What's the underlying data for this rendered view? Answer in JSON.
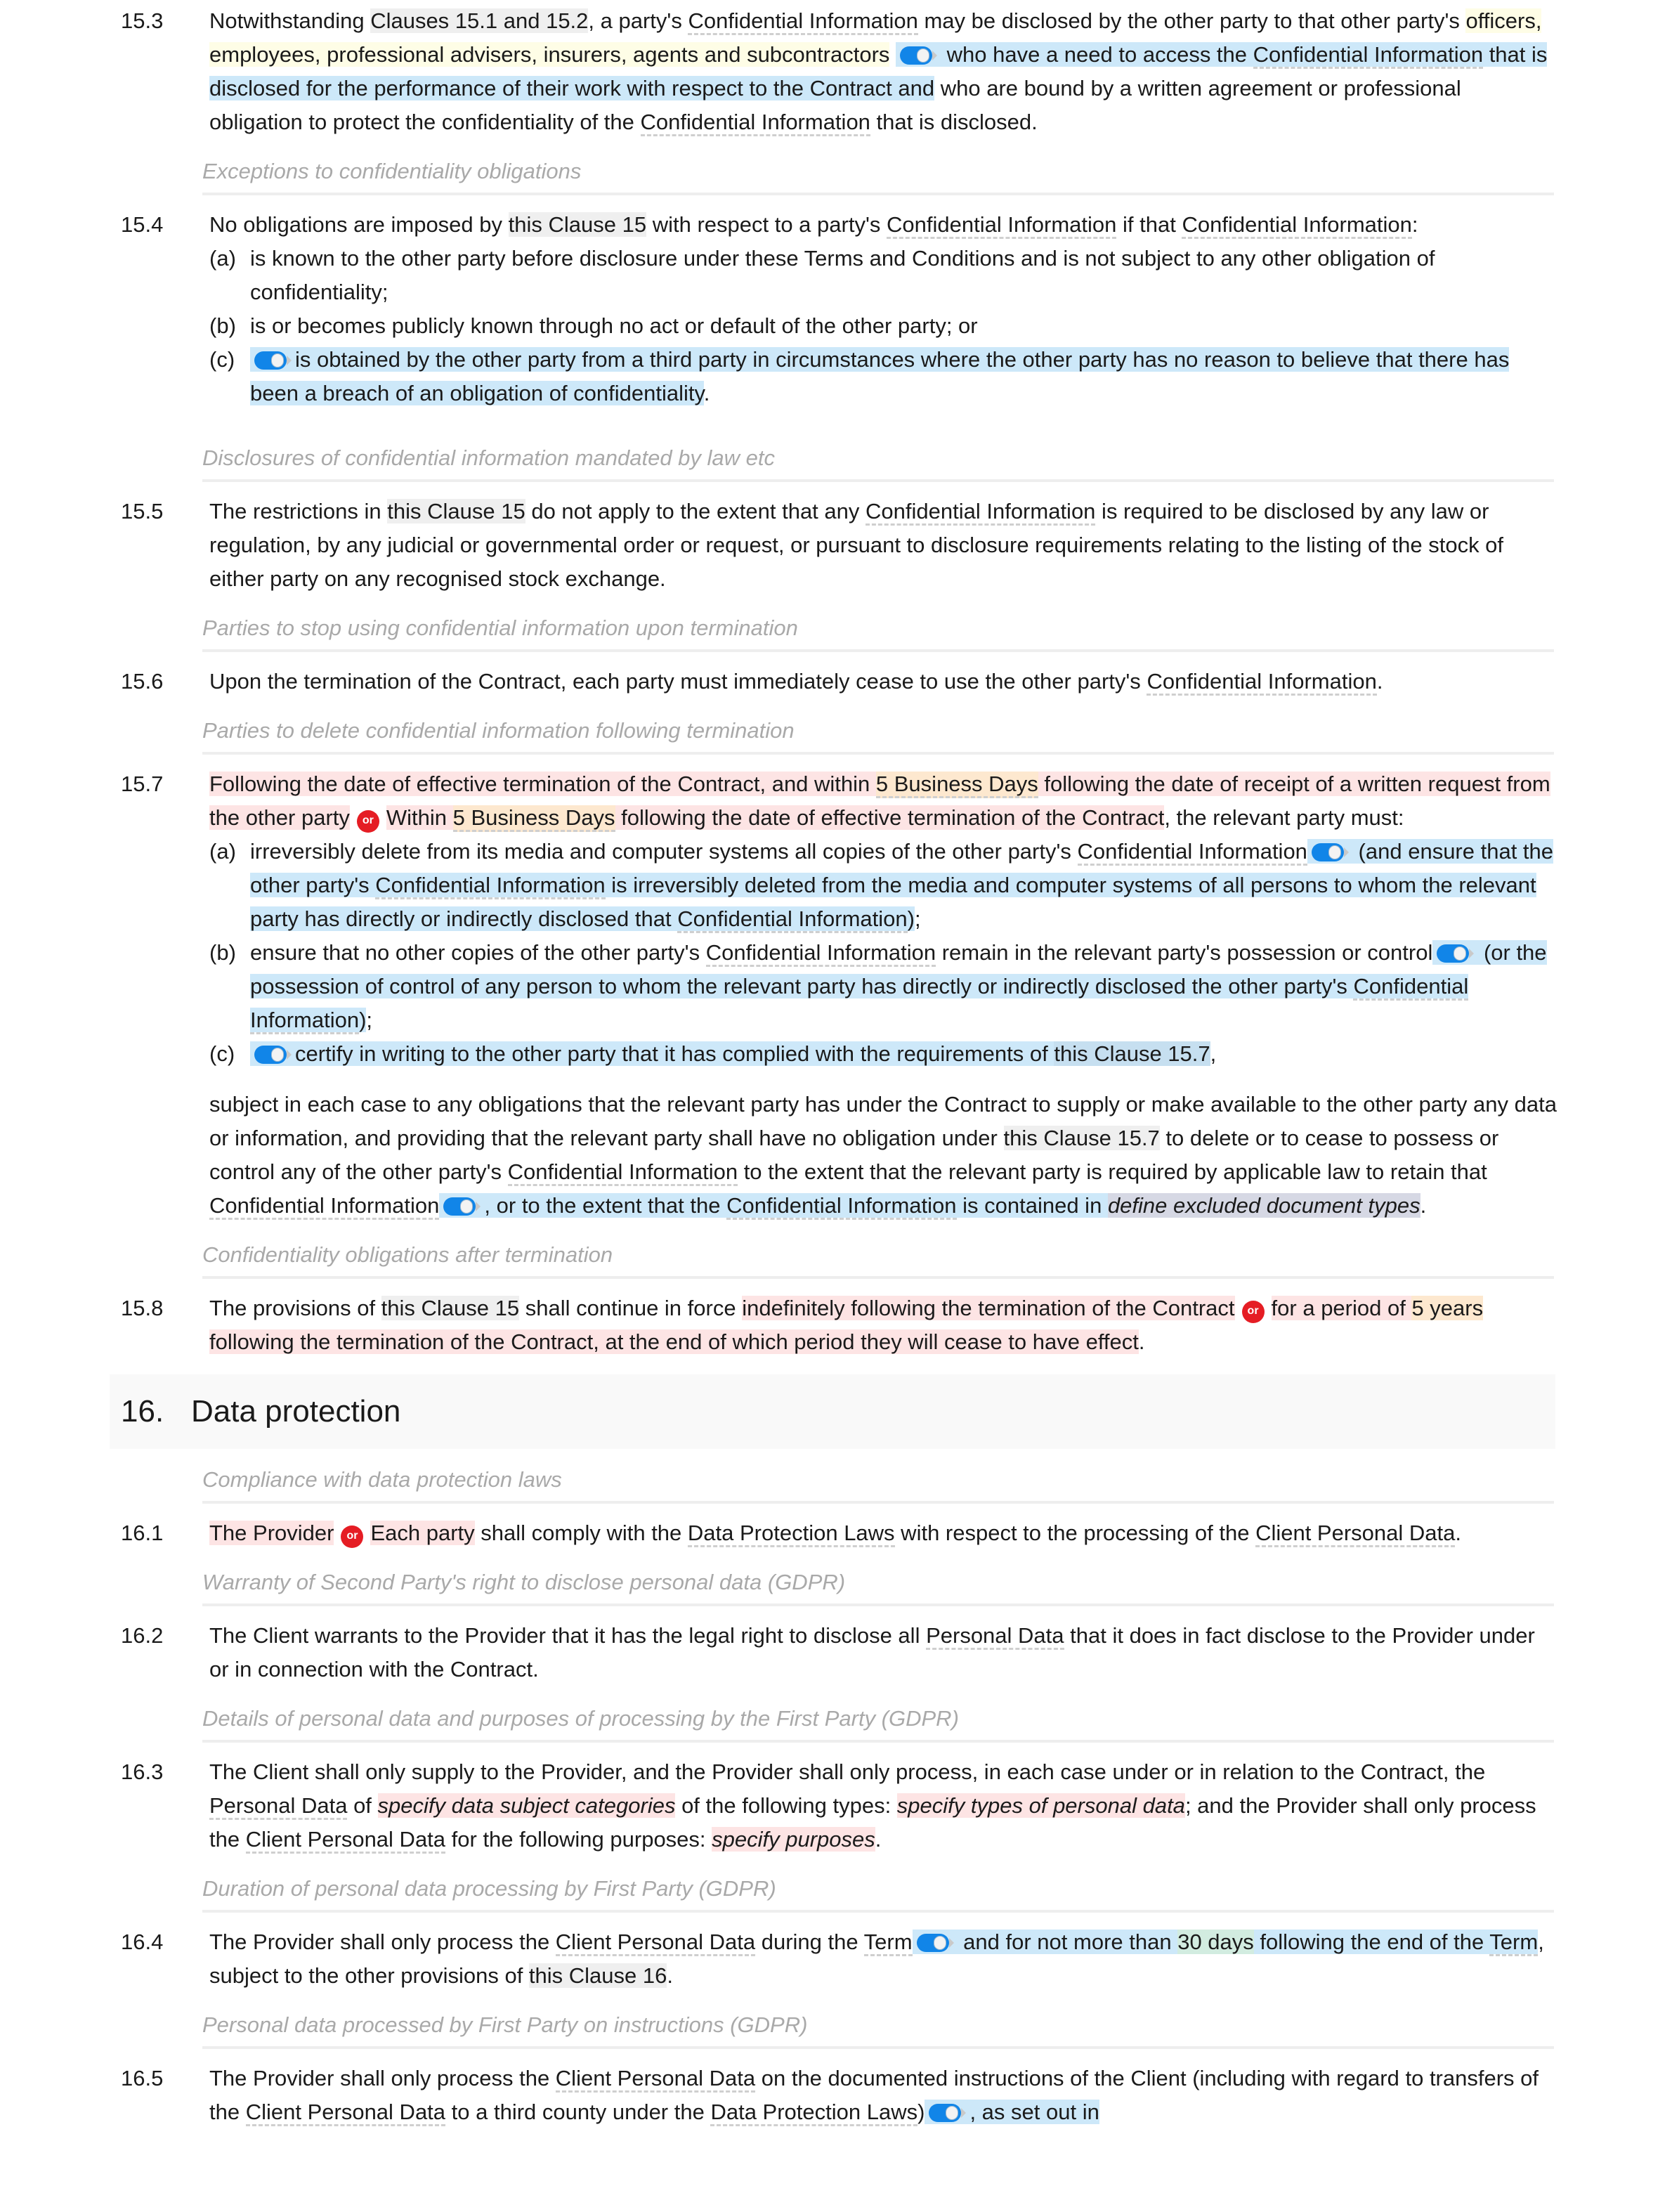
{
  "clause_15_3": {
    "number": "15.3",
    "p1": "Notwithstanding ",
    "xref1": "Clauses 15.1 and 15.2",
    "p2": ", a party's ",
    "def1": "Confidential Information",
    "p3": " may be disclosed by the other party to that other party's ",
    "yellow": "officers, employees, professional advisers, insurers, agents and subcontractors",
    "opt_a": " who have a need to access the ",
    "def2": "Confidential Information",
    "opt_b": " that is disclosed for the performance of their work with respect to the Contract and",
    "p4": " who are bound by a written agreement or professional obligation to protect the confidentiality of the ",
    "def3": "Confidential Information",
    "p5": " that is disclosed."
  },
  "heading_15_4": "Exceptions to confidentiality obligations",
  "clause_15_4": {
    "number": "15.4",
    "p1": "No obligations are imposed by ",
    "xref1": "this Clause 15",
    "p2": " with respect to a party's ",
    "def1": "Confidential Information",
    "p3": " if that ",
    "def2": "Confidential Information",
    "p4": ":",
    "items": [
      {
        "label": "(a)",
        "text": "is known to the other party before disclosure under these Terms and Conditions and is not subject to any other obligation of confidentiality;"
      },
      {
        "label": "(b)",
        "text": "is or becomes publicly known through no act or default of the other party; or"
      },
      {
        "label": "(c)",
        "text": "is obtained by the other party from a third party in circumstances where the other party has no reason to believe that there has been a breach of an obligation of confidentiality",
        "suffix": "."
      }
    ]
  },
  "heading_15_5": "Disclosures of confidential information mandated by law etc",
  "clause_15_5": {
    "number": "15.5",
    "p1": "The restrictions in ",
    "xref1": "this Clause 15",
    "p2": " do not apply to the extent that any ",
    "def1": "Confidential Information",
    "p3": " is required to be disclosed by any law or regulation, by any judicial or governmental order or request, or pursuant to disclosure requirements relating to the listing of the stock of either party on any recognised stock exchange."
  },
  "heading_15_6": "Parties to stop using confidential information upon termination",
  "clause_15_6": {
    "number": "15.6",
    "p1": "Upon the termination of the Contract, each party must immediately cease to use the other party's ",
    "def1": "Confidential Information",
    "p2": "."
  },
  "heading_15_7": "Parties to delete confidential information following termination",
  "clause_15_7": {
    "number": "15.7",
    "alt1_a": "Following the date of effective termination of the Contract, and within ",
    "alt1_var": "5 Business Days",
    "alt1_b": " following the date of receipt of a written request from the other party",
    "or_label": "or",
    "alt2_a": "Within ",
    "alt2_var": "5 Business Days",
    "alt2_b": " following the date of effective termination of the Contract",
    "p1": ", the relevant party must:",
    "item_a_label": "(a)",
    "item_a_p1": "irreversibly delete from its media and computer systems all copies of the other party's ",
    "item_a_def": "Confidential Information",
    "item_a_opt1": " (and ensure that the other party's ",
    "item_a_opt_def": "Confidential Information",
    "item_a_opt2": " is irreversibly deleted from the media and computer systems of all persons to whom the relevant party has directly or indirectly disclosed that ",
    "item_a_opt_def2": "Confidential Information",
    "item_a_opt3": ")",
    "item_a_end": ";",
    "item_b_label": "(b)",
    "item_b_p1": "ensure that no other copies of the other party's ",
    "item_b_def": "Confidential Information",
    "item_b_p2": " remain in the relevant party's possession or control",
    "item_b_opt1": " (or the possession of control of any person to whom the relevant party has directly or indirectly disclosed the other party's ",
    "item_b_opt_def": "Confidential Information",
    "item_b_opt2": ")",
    "item_b_end": ";",
    "item_c_label": "(c)",
    "item_c_opt": "certify in writing to the other party that it has complied with the requirements of ",
    "item_c_xref": "this Clause 15.7",
    "item_c_end": ",",
    "tail_p1": "subject in each case to any obligations that the relevant party has under the Contract to supply or make available to the other party any data or information, and providing that the relevant party shall have no obligation under ",
    "tail_xref": "this Clause 15.7",
    "tail_p2": " to delete or to cease to possess or control any of the other party's ",
    "tail_def1": "Confidential Information",
    "tail_p3": " to the extent that the relevant party is required by applicable law to retain that ",
    "tail_def2": "Confidential Information",
    "tail_opt1": ", or to the extent that the ",
    "tail_opt_def": "Confidential Information",
    "tail_opt2": " is contained in ",
    "tail_placeholder": "define excluded document types",
    "tail_end": "."
  },
  "heading_15_8": "Confidentiality obligations after termination",
  "clause_15_8": {
    "number": "15.8",
    "p1": "The provisions of ",
    "xref1": "this Clause 15",
    "p2": " shall continue in force ",
    "alt1": "indefinitely following the termination of the Contract",
    "or_label": "or",
    "alt2_a": "for a period of ",
    "alt2_var": "5 years",
    "alt2_b": " following the termination of the Contract, at the end of which period they will cease to have effect",
    "end": "."
  },
  "section_16": {
    "number": "16.",
    "title": "Data protection"
  },
  "heading_16_1": "Compliance with data protection laws",
  "clause_16_1": {
    "number": "16.1",
    "alt1": "The Provider",
    "or_label": "or",
    "alt2": "Each party",
    "p1": " shall comply with the ",
    "def1": "Data Protection Laws",
    "p2": " with respect to the processing of the ",
    "def2": "Client Personal Data",
    "p3": "."
  },
  "heading_16_2": "Warranty of Second Party's right to disclose personal data (GDPR)",
  "clause_16_2": {
    "number": "16.2",
    "p1": "The Client warrants to the Provider that it has the legal right to disclose all ",
    "def1": "Personal Data",
    "p2": " that it does in fact disclose to the Provider under or in connection with the Contract."
  },
  "heading_16_3": "Details of personal data and purposes of processing by the First Party (GDPR)",
  "clause_16_3": {
    "number": "16.3",
    "p1": "The Client shall only supply to the Provider, and the Provider shall only process, in each case under or in relation to the Contract, the ",
    "def1": "Personal Data",
    "p2": " of ",
    "ph1": "specify data subject categories",
    "p3": " of the following types: ",
    "ph2": "specify types of personal data",
    "p4": "; and the Provider shall only process the ",
    "def2": "Client Personal Data",
    "p5": " for the following purposes: ",
    "ph3": "specify purposes",
    "p6": "."
  },
  "heading_16_4": "Duration of personal data processing by First Party (GDPR)",
  "clause_16_4": {
    "number": "16.4",
    "p1": "The Provider shall only process the ",
    "def1": "Client Personal Data",
    "p2": " during the ",
    "def2": "Term",
    "opt1": " and for not more than ",
    "opt_var": "30 days",
    "opt2": " following the end of the ",
    "opt_def": "Term",
    "p3": ", subject to the other provisions of ",
    "xref1": "this Clause 16",
    "p4": "."
  },
  "heading_16_5": "Personal data processed by First Party on instructions (GDPR)",
  "clause_16_5": {
    "number": "16.5",
    "p1": "The Provider shall only process the ",
    "def1": "Client Personal Data",
    "p2": " on the documented instructions of the Client (including with regard to transfers of the ",
    "def2": "Client Personal Data",
    "p3": " to a third county under the ",
    "def3": "Data Protection Laws",
    "p4": ")",
    "opt1": ", as set out in"
  },
  "colors": {
    "optional_highlight": "#cde8f9",
    "alternative_highlight": "#fde4e4",
    "variable_highlight": "#fde8cf",
    "toggle_on": "#1185e8",
    "or_badge": "#e51d24",
    "heading_note": "#a9a9a9"
  }
}
